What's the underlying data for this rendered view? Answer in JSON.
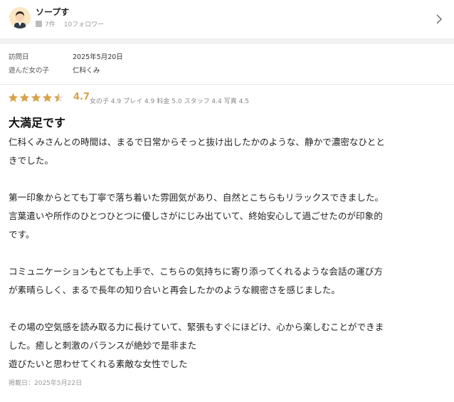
{
  "reviewer": {
    "name": "ソープす",
    "post_count": "7件",
    "followers": "10フォロワー"
  },
  "visit": {
    "date_label": "訪問日",
    "date_value": "2025年5月20日",
    "girl_label": "遊んだ女の子",
    "girl_value": "仁科くみ"
  },
  "rating": {
    "overall": "4.7",
    "stars_filled": 4.5,
    "star_color": "#d8a24b",
    "breakdown": [
      {
        "label": "女の子",
        "value": "4.9"
      },
      {
        "label": "プレイ",
        "value": "4.9"
      },
      {
        "label": "料金",
        "value": "5.0"
      },
      {
        "label": "スタッフ",
        "value": "4.4"
      },
      {
        "label": "写真",
        "value": "4.5"
      }
    ]
  },
  "review": {
    "title": "大満足です",
    "paragraphs": [
      [
        "仁科くみさんとの時間は、まるで日常からそっと抜け出したかのような、静かで濃密なひとと",
        "きでした。"
      ],
      [
        "第一印象からとても丁寧で落ち着いた雰囲気があり、自然とこちらもリラックスできました。",
        "言葉遣いや所作のひとつひとつに優しさがにじみ出ていて、終始安心して過ごせたのが印象的",
        "です。"
      ],
      [
        "コミュニケーションもとても上手で、こちらの気持ちに寄り添ってくれるような会話の運び方",
        "が素晴らしく、まるで長年の知り合いと再会したかのような親密さを感じました。"
      ],
      [
        "その場の空気感を読み取る力に長けていて、緊張もすぐにほどけ、心から楽しむことができま",
        "した。癒しと刺激のバランスが絶妙で是非また",
        "遊びたいと思わせてくれる素敵な女性でした"
      ]
    ],
    "posted": "掲載日：2025年5月22日"
  }
}
